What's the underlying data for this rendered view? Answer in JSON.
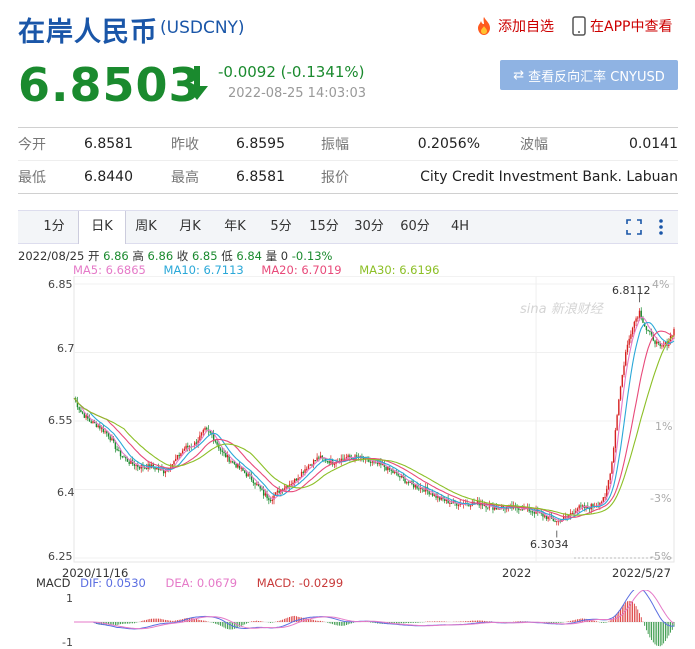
{
  "header": {
    "title": "在岸人民币",
    "code": "(USDCNY)",
    "add_watch": "添加自选",
    "app_view": "在APP中查看"
  },
  "quote": {
    "price": "6.8503",
    "change": "-0.0092 (-0.1341%)",
    "time": "2022-08-25 14:03:03",
    "reverse_button": "查看反向汇率 CNYUSD"
  },
  "stats": {
    "open_label": "今开",
    "open": "6.8581",
    "prev_close_label": "昨收",
    "prev_close": "6.8595",
    "amplitude_label": "振幅",
    "amplitude": "0.2056%",
    "volatility_label": "波幅",
    "volatility": "0.0141",
    "low_label": "最低",
    "low": "6.8440",
    "high_label": "最高",
    "high": "6.8581",
    "quote_label": "报价",
    "quote_source": "City Credit Investment Bank. Labuan"
  },
  "tabs": [
    "1分",
    "日K",
    "周K",
    "月K",
    "年K",
    "5分",
    "15分",
    "30分",
    "60分",
    "4H"
  ],
  "active_tab": "日K",
  "ohlc_info": {
    "date": "2022/08/25",
    "open_label": "开",
    "open": "6.86",
    "high_label": "高",
    "high": "6.86",
    "close_label": "收",
    "close": "6.85",
    "low_label": "低",
    "low": "6.84",
    "vol_label": "量",
    "vol": "0",
    "change": "-0.13%"
  },
  "ma": {
    "ma5": "MA5: 6.6865",
    "ma10": "MA10: 6.7113",
    "ma20": "MA20: 6.7019",
    "ma30": "MA30: 6.6196"
  },
  "colors": {
    "up": "#d62020",
    "down": "#1a8a2e",
    "ma5": "#e57ac8",
    "ma10": "#2aa8d8",
    "ma20": "#e84a7a",
    "ma30": "#8cbf26",
    "title": "#1a56a8"
  },
  "chart_data": {
    "type": "candlestick",
    "ylim": [
      6.25,
      6.85
    ],
    "yticks": [
      "6.85",
      "6.7",
      "6.55",
      "6.4",
      "6.25"
    ],
    "pct_ticks": [
      "4%",
      "1%",
      "-3%",
      "-5%"
    ],
    "x_labels": [
      "2020/11/16",
      "2022",
      "2022/5/27"
    ],
    "annotations": [
      "6.8112",
      "6.3034"
    ],
    "watermark": "sina 新浪财经",
    "close_path": [
      [
        0,
        6.6
      ],
      [
        4,
        6.57
      ],
      [
        9,
        6.55
      ],
      [
        14,
        6.54
      ],
      [
        20,
        6.52
      ],
      [
        26,
        6.48
      ],
      [
        32,
        6.46
      ],
      [
        38,
        6.45
      ],
      [
        45,
        6.45
      ],
      [
        52,
        6.44
      ],
      [
        58,
        6.46
      ],
      [
        64,
        6.49
      ],
      [
        70,
        6.5
      ],
      [
        76,
        6.53
      ],
      [
        80,
        6.52
      ],
      [
        86,
        6.48
      ],
      [
        92,
        6.46
      ],
      [
        98,
        6.44
      ],
      [
        104,
        6.42
      ],
      [
        110,
        6.39
      ],
      [
        114,
        6.38
      ],
      [
        120,
        6.4
      ],
      [
        128,
        6.42
      ],
      [
        135,
        6.45
      ],
      [
        142,
        6.47
      ],
      [
        150,
        6.46
      ],
      [
        158,
        6.47
      ],
      [
        165,
        6.47
      ],
      [
        172,
        6.46
      ],
      [
        180,
        6.45
      ],
      [
        188,
        6.43
      ],
      [
        196,
        6.41
      ],
      [
        204,
        6.4
      ],
      [
        212,
        6.38
      ],
      [
        220,
        6.37
      ],
      [
        228,
        6.37
      ],
      [
        236,
        6.37
      ],
      [
        244,
        6.36
      ],
      [
        252,
        6.36
      ],
      [
        260,
        6.36
      ],
      [
        268,
        6.35
      ],
      [
        274,
        6.34
      ],
      [
        280,
        6.33
      ],
      [
        286,
        6.34
      ],
      [
        292,
        6.36
      ],
      [
        298,
        6.36
      ],
      [
        304,
        6.37
      ],
      [
        308,
        6.38
      ],
      [
        312,
        6.46
      ],
      [
        316,
        6.6
      ],
      [
        320,
        6.7
      ],
      [
        324,
        6.76
      ],
      [
        328,
        6.79
      ],
      [
        332,
        6.75
      ],
      [
        336,
        6.73
      ],
      [
        340,
        6.71
      ],
      [
        344,
        6.72
      ],
      [
        348,
        6.75
      ]
    ],
    "ma_values": {
      "ma5": "6.6865",
      "ma10": "6.7113",
      "ma20": "6.7019",
      "ma30": "6.6196"
    },
    "macd": {
      "dif": "DIF: 0.0530",
      "dea": "DEA: 0.0679",
      "macd": "MACD: -0.0299",
      "label": "MACD",
      "yticks": [
        "1",
        "-1"
      ]
    }
  }
}
